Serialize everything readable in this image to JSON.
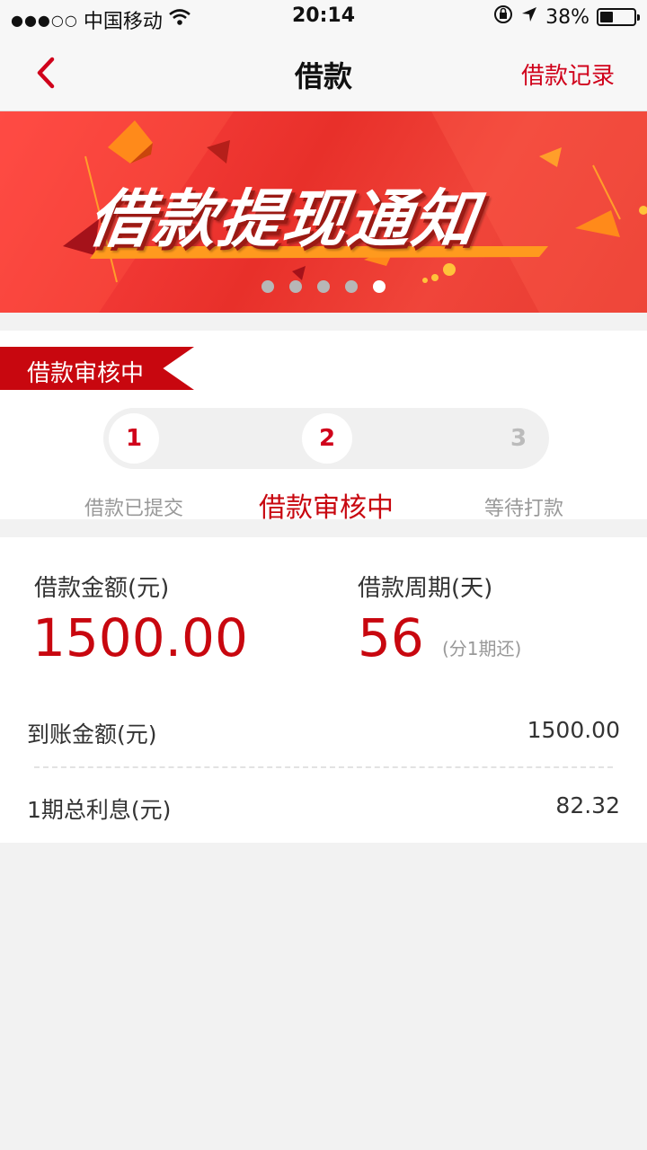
{
  "status_bar": {
    "signal": "●●●○○",
    "carrier": "中国移动",
    "time": "20:14",
    "battery": "38%",
    "battery_level": 0.38
  },
  "nav": {
    "title": "借款",
    "right_link": "借款记录",
    "back_icon": "chevron-left-icon"
  },
  "banner": {
    "headline": "借款提现通知",
    "dot_count": 5,
    "active_dot": 5
  },
  "progress": {
    "flag_label": "借款审核中",
    "steps": [
      {
        "number": "1",
        "label": "借款已提交",
        "state": "done"
      },
      {
        "number": "2",
        "label": "借款审核中",
        "state": "current"
      },
      {
        "number": "3",
        "label": "等待打款",
        "state": "pending"
      }
    ]
  },
  "loan": {
    "amount_label": "借款金额(元)",
    "amount": "1500.00",
    "period_label": "借款周期(天)",
    "period": "56",
    "period_note": "(分1期还)",
    "received_label": "到账金额(元)",
    "received": "1500.00",
    "interest_label": "1期总利息(元)",
    "interest": "82.32"
  },
  "colors": {
    "accent": "#c8070f",
    "link": "#d0021b",
    "banner": "#e8302a"
  }
}
